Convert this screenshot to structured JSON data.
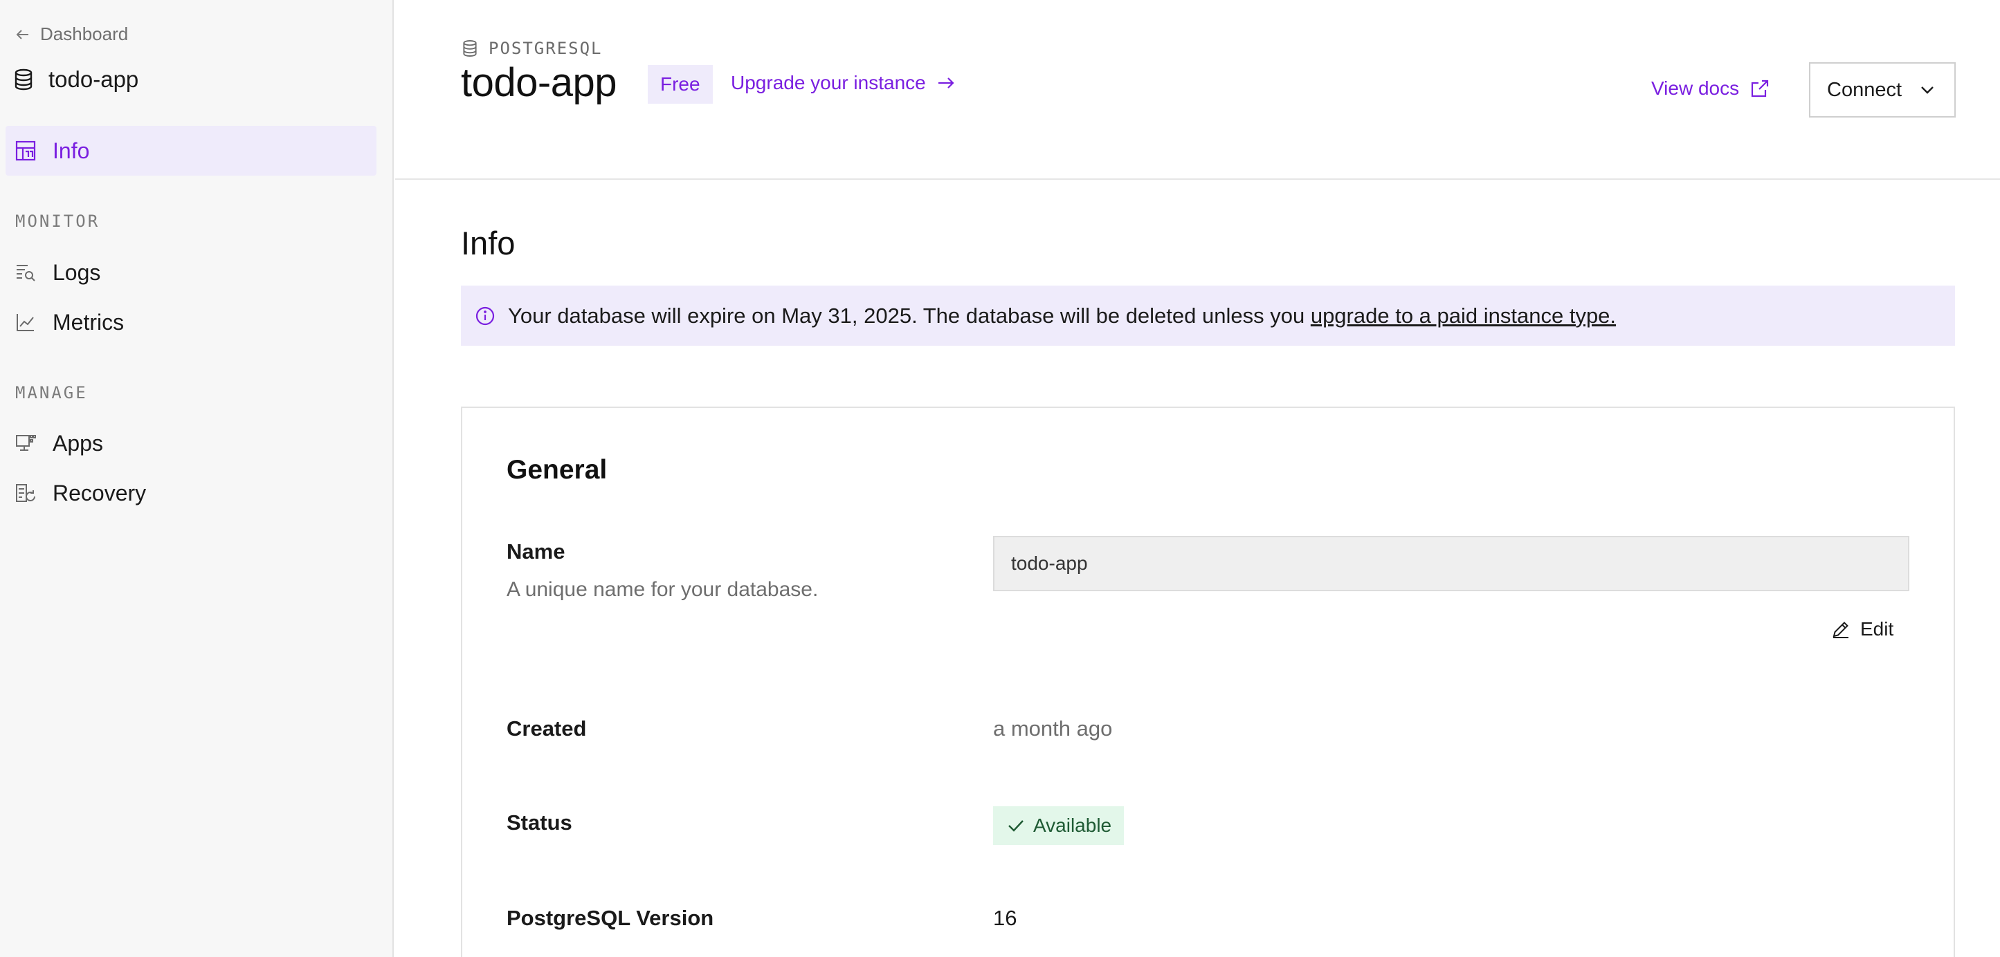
{
  "sidebar": {
    "back_label": "Dashboard",
    "db_name": "todo-app",
    "nav_info": "Info",
    "section_monitor": "MONITOR",
    "nav_logs": "Logs",
    "nav_metrics": "Metrics",
    "section_manage": "MANAGE",
    "nav_apps": "Apps",
    "nav_recovery": "Recovery"
  },
  "header": {
    "eyebrow": "POSTGRESQL",
    "title": "todo-app",
    "plan_badge": "Free",
    "upgrade_link": "Upgrade your instance",
    "docs_link": "View docs",
    "connect_label": "Connect"
  },
  "main": {
    "heading": "Info",
    "alert_text": "Your database will expire on May 31, 2025. The database will be deleted unless you ",
    "alert_link": "upgrade to a paid instance type."
  },
  "general": {
    "title": "General",
    "name_label": "Name",
    "name_desc": "A unique name for your database.",
    "name_value": "todo-app",
    "edit_label": "Edit",
    "created_label": "Created",
    "created_value": "a month ago",
    "status_label": "Status",
    "status_value": "Available",
    "version_label": "PostgreSQL Version",
    "version_value": "16"
  },
  "colors": {
    "accent": "#7a1fe0",
    "accent_bg": "#efebfb",
    "status_bg": "#e3f7ea",
    "status_fg": "#1f5b34"
  }
}
